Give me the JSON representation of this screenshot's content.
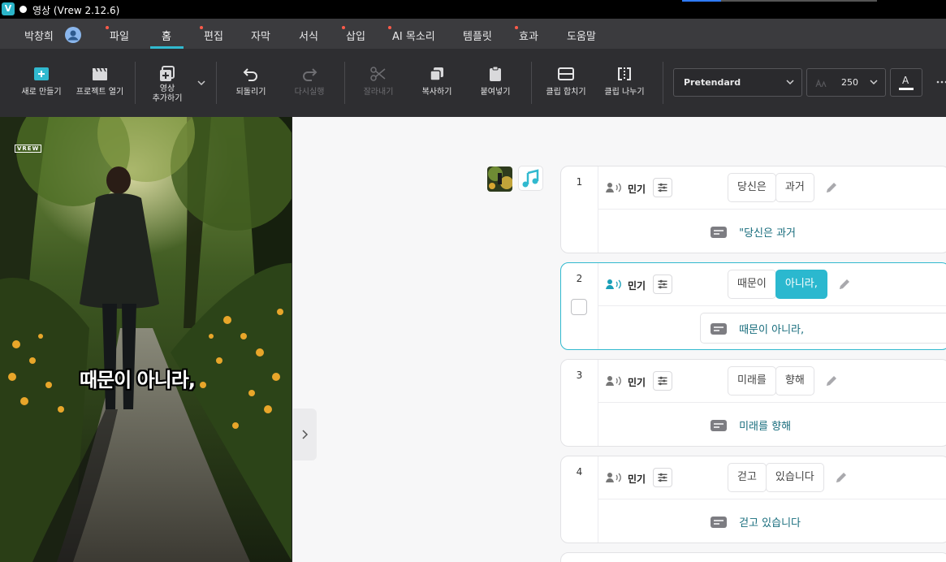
{
  "titlebar": {
    "logo": "V",
    "title": "영상 (Vrew 2.12.6)"
  },
  "menubar": {
    "user": "박창희",
    "items": [
      {
        "label": "파일",
        "dot": true
      },
      {
        "label": "홈",
        "dot": false,
        "active": true
      },
      {
        "label": "편집",
        "dot": true
      },
      {
        "label": "자막",
        "dot": false
      },
      {
        "label": "서식",
        "dot": false
      },
      {
        "label": "삽입",
        "dot": true
      },
      {
        "label": "AI 목소리",
        "dot": true
      },
      {
        "label": "템플릿",
        "dot": false
      },
      {
        "label": "효과",
        "dot": true
      },
      {
        "label": "도움말",
        "dot": false
      }
    ]
  },
  "toolbar": {
    "new": "새로 만들기",
    "open": "프로젝트 열기",
    "add_video_1": "영상",
    "add_video_2": "추가하기",
    "undo": "되돌리기",
    "redo": "다시실행",
    "cut": "잘라내기",
    "copy": "복사하기",
    "paste": "붙여넣기",
    "merge": "클립 합치기",
    "split": "클립 나누기",
    "font": "Pretendard",
    "font_size": "250",
    "font_color_label": "A",
    "accent": "#31b9cf"
  },
  "preview": {
    "watermark": "VREW",
    "caption": "때문이 아니라,"
  },
  "clips": [
    {
      "num": "1",
      "speaker": "민기",
      "words": [
        "당신은",
        "과거"
      ],
      "subtitle": "\"당신은 과거"
    },
    {
      "num": "2",
      "speaker": "민기",
      "words": [
        "때문이",
        "아니라,"
      ],
      "highlight": 1,
      "subtitle": "때문이 아니라,"
    },
    {
      "num": "3",
      "speaker": "민기",
      "words": [
        "미래를",
        "향해"
      ],
      "subtitle": "미래를 향해"
    },
    {
      "num": "4",
      "speaker": "민기",
      "words": [
        "걷고",
        "있습니다"
      ],
      "subtitle": "걷고 있습니다"
    }
  ]
}
